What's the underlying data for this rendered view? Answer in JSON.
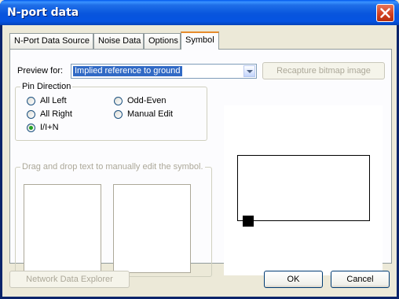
{
  "window": {
    "title": "N-port data"
  },
  "tabs": [
    {
      "label": "N-Port Data Source"
    },
    {
      "label": "Noise Data"
    },
    {
      "label": "Options"
    },
    {
      "label": "Symbol"
    }
  ],
  "symbol_tab": {
    "preview_label": "Preview for:",
    "preview_selected": "Implied reference to ground",
    "recapture_button": "Recapture bitmap image",
    "pin_direction": {
      "caption": "Pin Direction",
      "options": [
        "All Left",
        "Odd-Even",
        "All Right",
        "Manual Edit",
        "I/I+N"
      ],
      "selected": "I/I+N"
    },
    "edit_group_caption": "Drag and drop text to manually edit the symbol."
  },
  "footer": {
    "explorer_button": "Network Data Explorer",
    "ok_button": "OK",
    "cancel_button": "Cancel"
  },
  "colors": {
    "titlebar": "#0553e1",
    "tab_highlight": "#e68b2c",
    "selection": "#316ac5",
    "radio_dot": "#21a121"
  }
}
